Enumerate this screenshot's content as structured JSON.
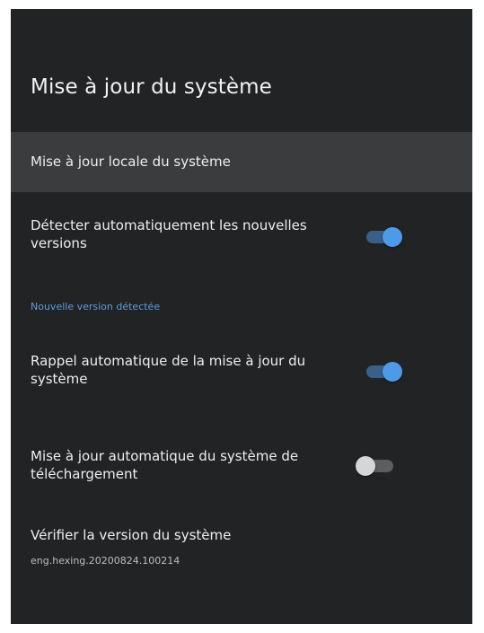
{
  "header": {
    "title": "Mise à jour du système"
  },
  "items": {
    "local_update": {
      "label": "Mise à jour locale du système"
    },
    "auto_detect": {
      "label_line1": "Détecter automatiquement les nouvelles",
      "label_line2": "versions",
      "enabled": true
    },
    "section_new_version": {
      "label": "Nouvelle version détectée"
    },
    "auto_reminder": {
      "label_line1": "Rappel automatique de la mise à jour du",
      "label_line2": "système",
      "enabled": true
    },
    "auto_download": {
      "label_line1": "Mise à jour automatique du système de",
      "label_line2": "téléchargement",
      "enabled": false
    },
    "check_version": {
      "label": "Vérifier la version du système",
      "value": "eng.hexing.20200824.100214"
    }
  },
  "colors": {
    "background": "#222324",
    "selected_row": "#3b3c3e",
    "accent": "#4d9be8",
    "section_header": "#5b9de0"
  }
}
